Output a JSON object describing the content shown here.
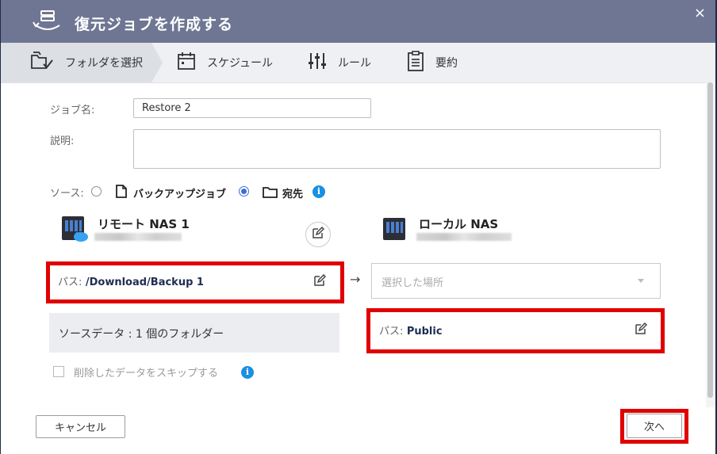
{
  "dialog": {
    "title": "復元ジョブを作成する",
    "close": "×"
  },
  "steps": [
    {
      "label": "フォルダを選択",
      "icon": "folder-check-icon",
      "active": true
    },
    {
      "label": "スケジュール",
      "icon": "calendar-icon",
      "active": false
    },
    {
      "label": "ルール",
      "icon": "sliders-icon",
      "active": false
    },
    {
      "label": "要約",
      "icon": "clipboard-icon",
      "active": false
    }
  ],
  "form": {
    "job_name_label": "ジョブ名:",
    "job_name_value": "Restore 2",
    "description_label": "説明:",
    "description_value": "",
    "source_label": "ソース:",
    "source_option_backup": "バックアップジョブ",
    "source_option_destination": "宛先",
    "source_selected": "宛先"
  },
  "remote": {
    "name": "リモート NAS 1",
    "path_label": "パス:",
    "path_value": "/Download/Backup 1",
    "source_data": "ソースデータ : 1 個のフォルダー"
  },
  "local": {
    "name": "ローカル NAS",
    "select_placeholder": "選択した場所",
    "path_label": "パス:",
    "path_value": "Public"
  },
  "arrow": "→",
  "skip_deleted_label": "削除したデータをスキップする",
  "buttons": {
    "cancel": "キャンセル",
    "next": "次へ"
  },
  "colors": {
    "titlebar": "#6e7693",
    "highlight": "#e00000",
    "accent": "#3b6fd6",
    "info": "#1a8fe3"
  }
}
